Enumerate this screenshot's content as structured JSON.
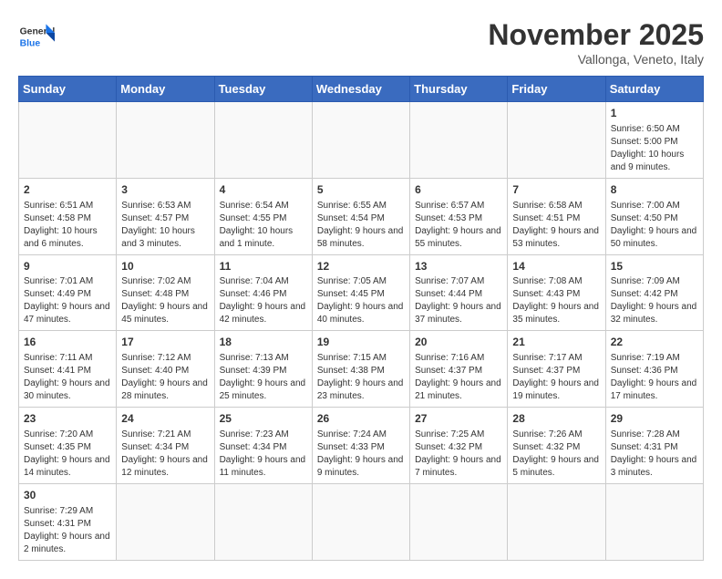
{
  "header": {
    "logo_general": "General",
    "logo_blue": "Blue",
    "month_title": "November 2025",
    "location": "Vallonga, Veneto, Italy"
  },
  "days_of_week": [
    "Sunday",
    "Monday",
    "Tuesday",
    "Wednesday",
    "Thursday",
    "Friday",
    "Saturday"
  ],
  "weeks": [
    [
      {
        "day": "",
        "info": ""
      },
      {
        "day": "",
        "info": ""
      },
      {
        "day": "",
        "info": ""
      },
      {
        "day": "",
        "info": ""
      },
      {
        "day": "",
        "info": ""
      },
      {
        "day": "",
        "info": ""
      },
      {
        "day": "1",
        "info": "Sunrise: 6:50 AM\nSunset: 5:00 PM\nDaylight: 10 hours and 9 minutes."
      }
    ],
    [
      {
        "day": "2",
        "info": "Sunrise: 6:51 AM\nSunset: 4:58 PM\nDaylight: 10 hours and 6 minutes."
      },
      {
        "day": "3",
        "info": "Sunrise: 6:53 AM\nSunset: 4:57 PM\nDaylight: 10 hours and 3 minutes."
      },
      {
        "day": "4",
        "info": "Sunrise: 6:54 AM\nSunset: 4:55 PM\nDaylight: 10 hours and 1 minute."
      },
      {
        "day": "5",
        "info": "Sunrise: 6:55 AM\nSunset: 4:54 PM\nDaylight: 9 hours and 58 minutes."
      },
      {
        "day": "6",
        "info": "Sunrise: 6:57 AM\nSunset: 4:53 PM\nDaylight: 9 hours and 55 minutes."
      },
      {
        "day": "7",
        "info": "Sunrise: 6:58 AM\nSunset: 4:51 PM\nDaylight: 9 hours and 53 minutes."
      },
      {
        "day": "8",
        "info": "Sunrise: 7:00 AM\nSunset: 4:50 PM\nDaylight: 9 hours and 50 minutes."
      }
    ],
    [
      {
        "day": "9",
        "info": "Sunrise: 7:01 AM\nSunset: 4:49 PM\nDaylight: 9 hours and 47 minutes."
      },
      {
        "day": "10",
        "info": "Sunrise: 7:02 AM\nSunset: 4:48 PM\nDaylight: 9 hours and 45 minutes."
      },
      {
        "day": "11",
        "info": "Sunrise: 7:04 AM\nSunset: 4:46 PM\nDaylight: 9 hours and 42 minutes."
      },
      {
        "day": "12",
        "info": "Sunrise: 7:05 AM\nSunset: 4:45 PM\nDaylight: 9 hours and 40 minutes."
      },
      {
        "day": "13",
        "info": "Sunrise: 7:07 AM\nSunset: 4:44 PM\nDaylight: 9 hours and 37 minutes."
      },
      {
        "day": "14",
        "info": "Sunrise: 7:08 AM\nSunset: 4:43 PM\nDaylight: 9 hours and 35 minutes."
      },
      {
        "day": "15",
        "info": "Sunrise: 7:09 AM\nSunset: 4:42 PM\nDaylight: 9 hours and 32 minutes."
      }
    ],
    [
      {
        "day": "16",
        "info": "Sunrise: 7:11 AM\nSunset: 4:41 PM\nDaylight: 9 hours and 30 minutes."
      },
      {
        "day": "17",
        "info": "Sunrise: 7:12 AM\nSunset: 4:40 PM\nDaylight: 9 hours and 28 minutes."
      },
      {
        "day": "18",
        "info": "Sunrise: 7:13 AM\nSunset: 4:39 PM\nDaylight: 9 hours and 25 minutes."
      },
      {
        "day": "19",
        "info": "Sunrise: 7:15 AM\nSunset: 4:38 PM\nDaylight: 9 hours and 23 minutes."
      },
      {
        "day": "20",
        "info": "Sunrise: 7:16 AM\nSunset: 4:37 PM\nDaylight: 9 hours and 21 minutes."
      },
      {
        "day": "21",
        "info": "Sunrise: 7:17 AM\nSunset: 4:37 PM\nDaylight: 9 hours and 19 minutes."
      },
      {
        "day": "22",
        "info": "Sunrise: 7:19 AM\nSunset: 4:36 PM\nDaylight: 9 hours and 17 minutes."
      }
    ],
    [
      {
        "day": "23",
        "info": "Sunrise: 7:20 AM\nSunset: 4:35 PM\nDaylight: 9 hours and 14 minutes."
      },
      {
        "day": "24",
        "info": "Sunrise: 7:21 AM\nSunset: 4:34 PM\nDaylight: 9 hours and 12 minutes."
      },
      {
        "day": "25",
        "info": "Sunrise: 7:23 AM\nSunset: 4:34 PM\nDaylight: 9 hours and 11 minutes."
      },
      {
        "day": "26",
        "info": "Sunrise: 7:24 AM\nSunset: 4:33 PM\nDaylight: 9 hours and 9 minutes."
      },
      {
        "day": "27",
        "info": "Sunrise: 7:25 AM\nSunset: 4:32 PM\nDaylight: 9 hours and 7 minutes."
      },
      {
        "day": "28",
        "info": "Sunrise: 7:26 AM\nSunset: 4:32 PM\nDaylight: 9 hours and 5 minutes."
      },
      {
        "day": "29",
        "info": "Sunrise: 7:28 AM\nSunset: 4:31 PM\nDaylight: 9 hours and 3 minutes."
      }
    ],
    [
      {
        "day": "30",
        "info": "Sunrise: 7:29 AM\nSunset: 4:31 PM\nDaylight: 9 hours and 2 minutes."
      },
      {
        "day": "",
        "info": ""
      },
      {
        "day": "",
        "info": ""
      },
      {
        "day": "",
        "info": ""
      },
      {
        "day": "",
        "info": ""
      },
      {
        "day": "",
        "info": ""
      },
      {
        "day": "",
        "info": ""
      }
    ]
  ]
}
